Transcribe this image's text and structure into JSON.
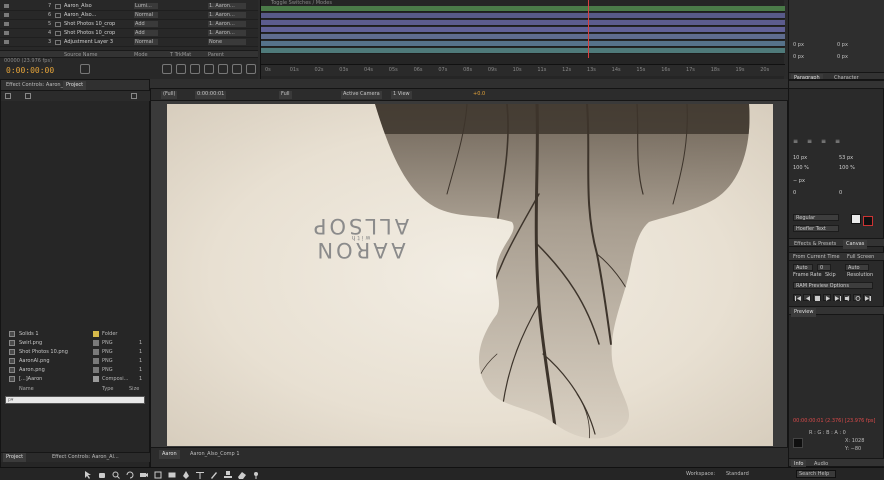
{
  "app": {
    "accent_color": "#e5a43a",
    "playhead_color": "#d84141"
  },
  "timeline": {
    "current_time": "0:00:00:00",
    "time_sub": "00000 (23.976 fps)",
    "col_headers": {
      "source_name": "Source Name",
      "mode": "Mode",
      "trkmat": "T  TrkMat",
      "parent": "Parent"
    },
    "layers": [
      {
        "num": "1",
        "name": "[Rule_Of_Thirds_Comp 1]",
        "mode": "Normal",
        "parent": "None"
      },
      {
        "num": "2",
        "name": "Adjustment Layer 2",
        "mode": "Normal",
        "parent": "None"
      },
      {
        "num": "3",
        "name": "Adjustment Layer 3",
        "mode": "Normal",
        "parent": "None"
      },
      {
        "num": "4",
        "name": "Shot Photos 10_crop",
        "mode": "Add",
        "parent": "1. Aaron..."
      },
      {
        "num": "5",
        "name": "Shot Photos 10_crop",
        "mode": "Add",
        "parent": "1. Aaron..."
      },
      {
        "num": "6",
        "name": "Aaron_Also...",
        "mode": "Normal",
        "parent": "1. Aaron..."
      },
      {
        "num": "7",
        "name": "Aaron_Also",
        "mode": "Lumi...",
        "parent": "1. Aaron..."
      }
    ],
    "header_label": "Toggle Switches / Modes",
    "ruler_labels": [
      "0s",
      "01s",
      "02s",
      "03s",
      "04s",
      "05s",
      "06s",
      "07s",
      "08s",
      "09s",
      "10s",
      "11s",
      "12s",
      "13s",
      "14s",
      "15s",
      "16s",
      "17s",
      "18s",
      "19s",
      "20s"
    ],
    "track_colors": [
      "#4a7a48",
      "#585a88",
      "#5c5c8e",
      "#616196",
      "#5f6c8e",
      "#56728a",
      "#4f7a7a"
    ]
  },
  "project": {
    "tabs": [
      "Project",
      "Effect Controls: Aaron_Al..."
    ],
    "search_value": "",
    "search_placeholder": "ρ▾",
    "columns": {
      "name": "Name",
      "type": "Type",
      "size": "Size"
    },
    "items": [
      {
        "name": "Solids 1",
        "type": "Folder",
        "num": "",
        "swatch": "#d6b94b"
      },
      {
        "name": "Swirl.png",
        "type": "PNG",
        "num": "1",
        "swatch": "#8a8a8a"
      },
      {
        "name": "Shot Photos 10.png",
        "type": "PNG",
        "num": "1",
        "swatch": "#8a8a8a"
      },
      {
        "name": "AaronAl.png",
        "type": "PNG",
        "num": "1",
        "swatch": "#8a8a8a"
      },
      {
        "name": "Aaron.png",
        "type": "PNG",
        "num": "1",
        "swatch": "#8a8a8a"
      },
      {
        "name": "[...]Aaron",
        "type": "Composi...",
        "num": "1",
        "swatch": "#9a9a9a"
      }
    ]
  },
  "composition": {
    "header_tabs": [
      "Composition: Aaron",
      "Aaron_Also_Comp 1"
    ],
    "controls": {
      "zoom": "Full",
      "timecode": "0:00:00:01",
      "camera": "Active Camera",
      "views": "1 View",
      "exposure": "+0.0",
      "resolution": "(Full)"
    },
    "bottom_tabs": [
      "Aaron",
      "Aaron_Also_Comp 1"
    ],
    "title_text": "AARON ALLSOP",
    "subtitle_text": "with"
  },
  "right_panel": {
    "character_tabs": [
      "Paragraph",
      "Character"
    ],
    "character": {
      "font": "Hoefler Text",
      "style": "Regular",
      "size": "10 px",
      "leading": "53 px",
      "tracking": "0",
      "kerning": "0",
      "scale_v": "100 %",
      "scale_h": "100 %",
      "stroke": "− px",
      "indent_left": "0 px",
      "indent_right": "0 px",
      "space_before": "0 px",
      "space_after": "0 px"
    },
    "effects_tabs": [
      "Effects & Presets",
      "Canvas"
    ],
    "preview": {
      "header": "Preview",
      "ram_options": "RAM Preview Options",
      "frame_rate_label": "Frame Rate",
      "skip_label": "Skip",
      "resolution_label": "Resolution",
      "frame_rate": "Auto",
      "skip": "0",
      "resolution": "Auto",
      "from_current": "From Current Time",
      "full_screen": "Full Screen"
    },
    "info": {
      "header": "Info",
      "audio_tab": "Audio",
      "red_text": "00:00:00:01 (2.376) [23.976 fps]",
      "x_label": "X: 1028",
      "y_label": "Y: −80"
    }
  },
  "bottom_bar": {
    "toggle_label": "Toggle Switches / Modes",
    "workspace_label": "Workspace:",
    "workspace_value": "Standard",
    "search_help": "Search Help"
  }
}
